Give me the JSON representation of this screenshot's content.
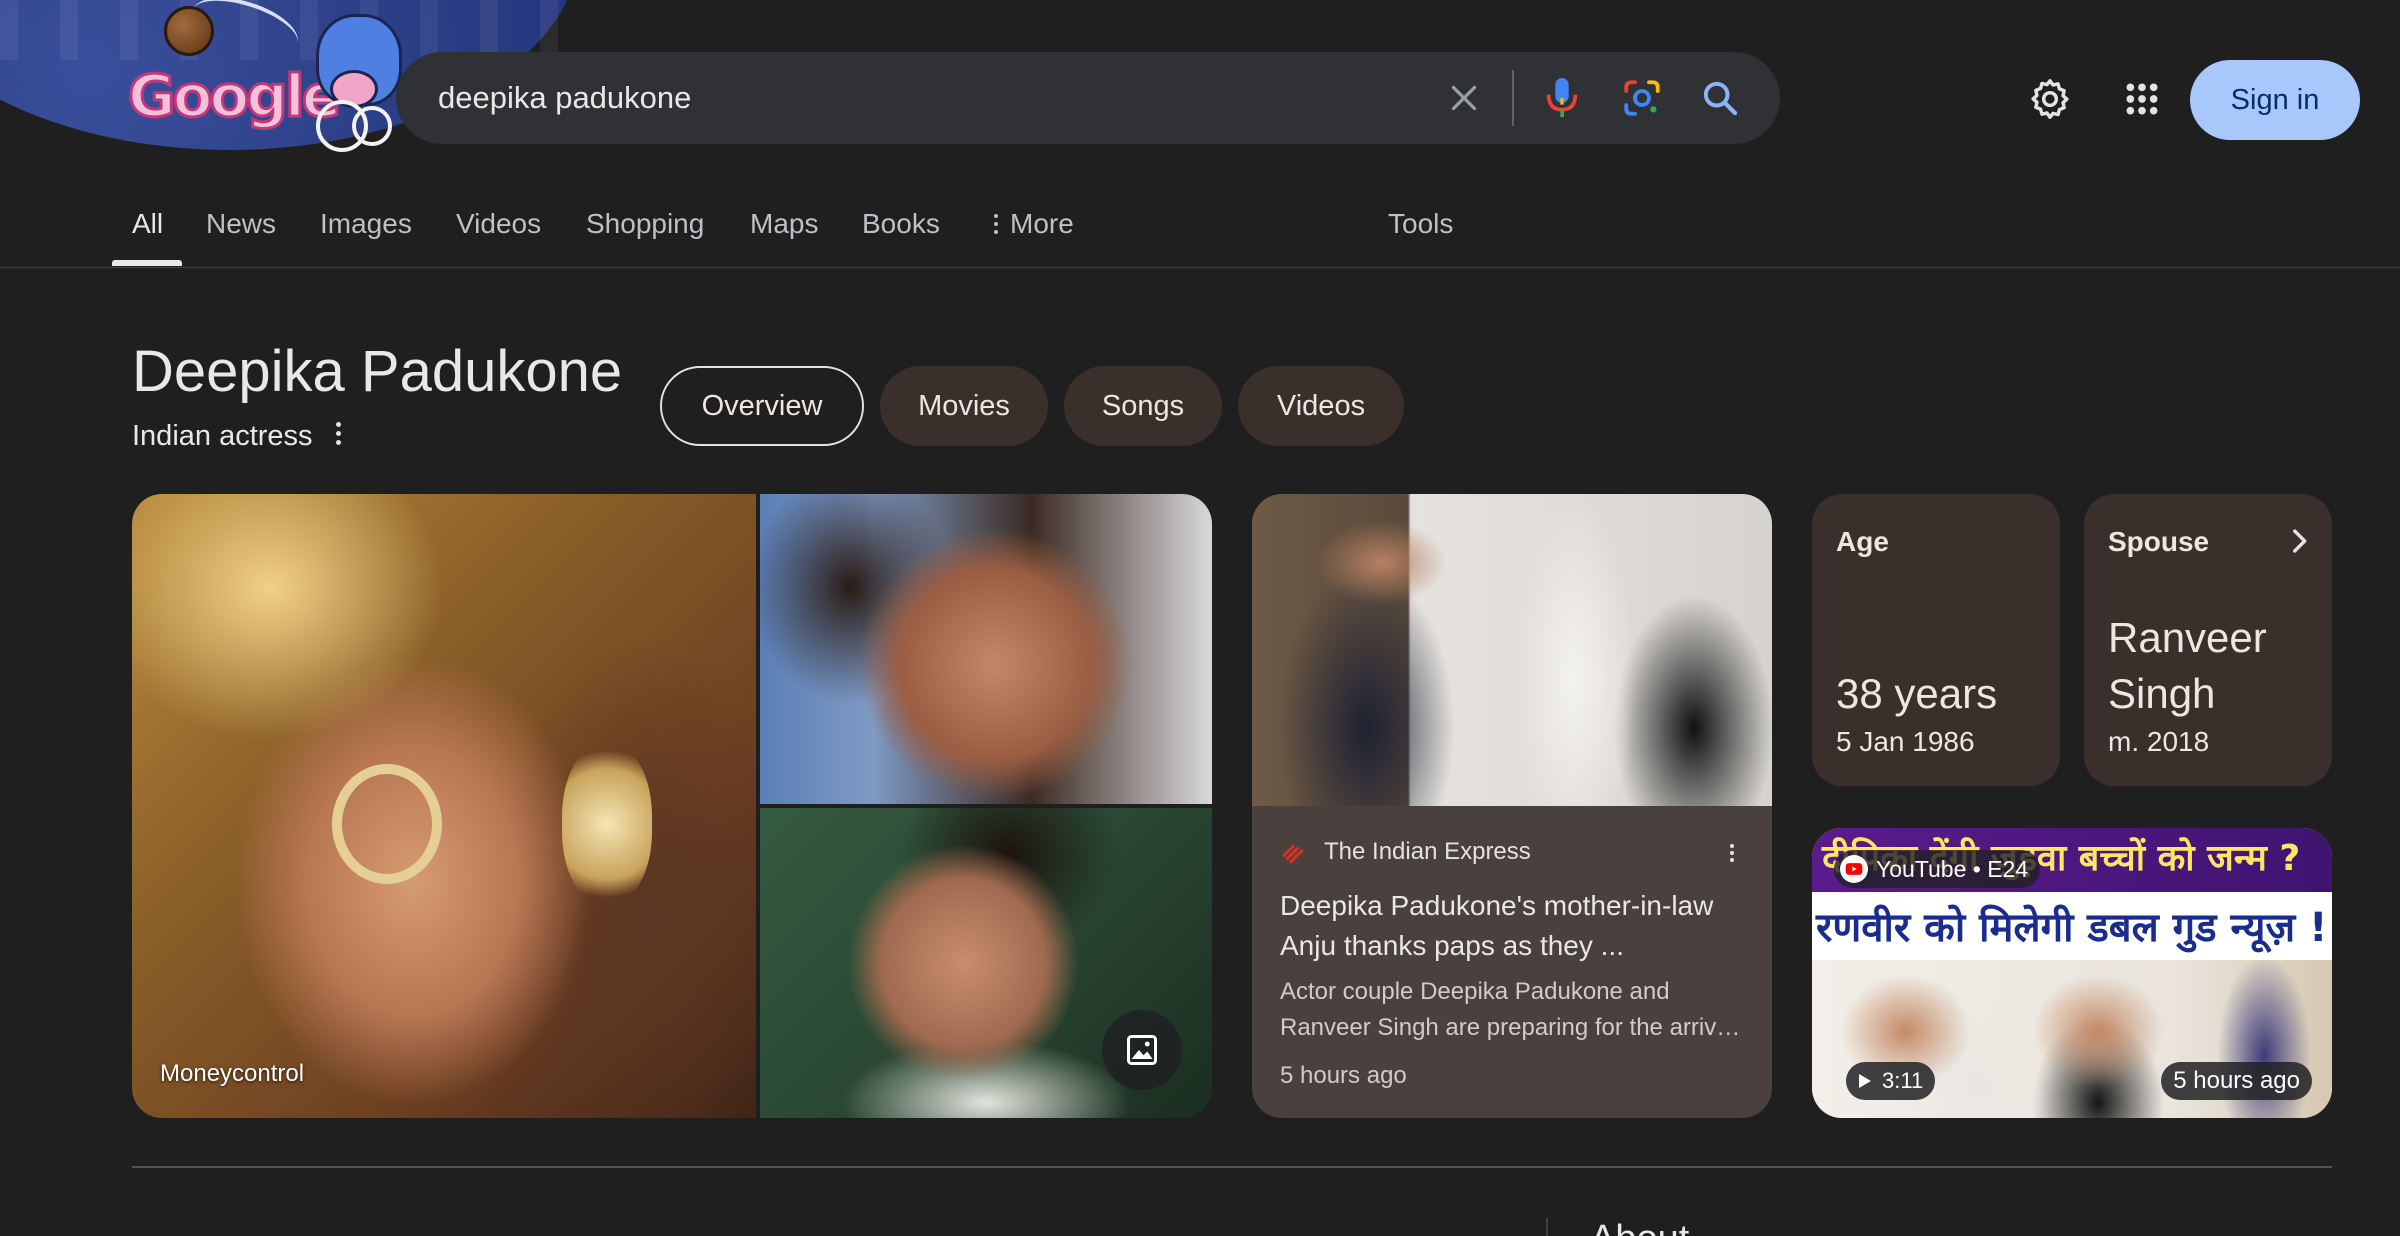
{
  "search": {
    "query": "deepika padukone"
  },
  "logo": {
    "text": "Google"
  },
  "header": {
    "signin_label": "Sign in"
  },
  "tabs": [
    {
      "label": "All",
      "active": true
    },
    {
      "label": "News"
    },
    {
      "label": "Images"
    },
    {
      "label": "Videos"
    },
    {
      "label": "Shopping"
    },
    {
      "label": "Maps"
    },
    {
      "label": "Books"
    },
    {
      "label": "More"
    },
    {
      "label": "Tools"
    }
  ],
  "entity": {
    "title": "Deepika Padukone",
    "subtitle": "Indian actress",
    "chips": [
      {
        "label": "Overview",
        "selected": true
      },
      {
        "label": "Movies"
      },
      {
        "label": "Songs"
      },
      {
        "label": "Videos"
      }
    ]
  },
  "images": {
    "main_caption": "Moneycontrol"
  },
  "news": {
    "source": "The Indian Express",
    "headline_line1": "Deepika Padukone's mother-in-law",
    "headline_line2": "Anju thanks paps as they ...",
    "snippet_line1": "Actor couple Deepika Padukone and",
    "snippet_line2": "Ranveer Singh are preparing for the arriv…",
    "time": "5 hours ago"
  },
  "facts": {
    "age": {
      "label": "Age",
      "value": "38 years",
      "sub": "5 Jan 1986"
    },
    "spouse": {
      "label": "Spouse",
      "value_line1": "Ranveer",
      "value_line2": "Singh",
      "sub": "m. 2018"
    }
  },
  "video": {
    "thumb_line1": "दीपिका देंगी जुड़वा बच्चों को जन्म ?",
    "thumb_line2": "रणवीर को मिलेगी डबल गुड न्यूज़ !",
    "source": "YouTube • E24",
    "duration": "3:11",
    "time": "5 hours ago"
  },
  "about": {
    "heading": "About"
  },
  "colors": {
    "accent": "#a8c7fa",
    "chip_bg": "#3b2f2c",
    "page_bg": "#1f1f1f"
  }
}
